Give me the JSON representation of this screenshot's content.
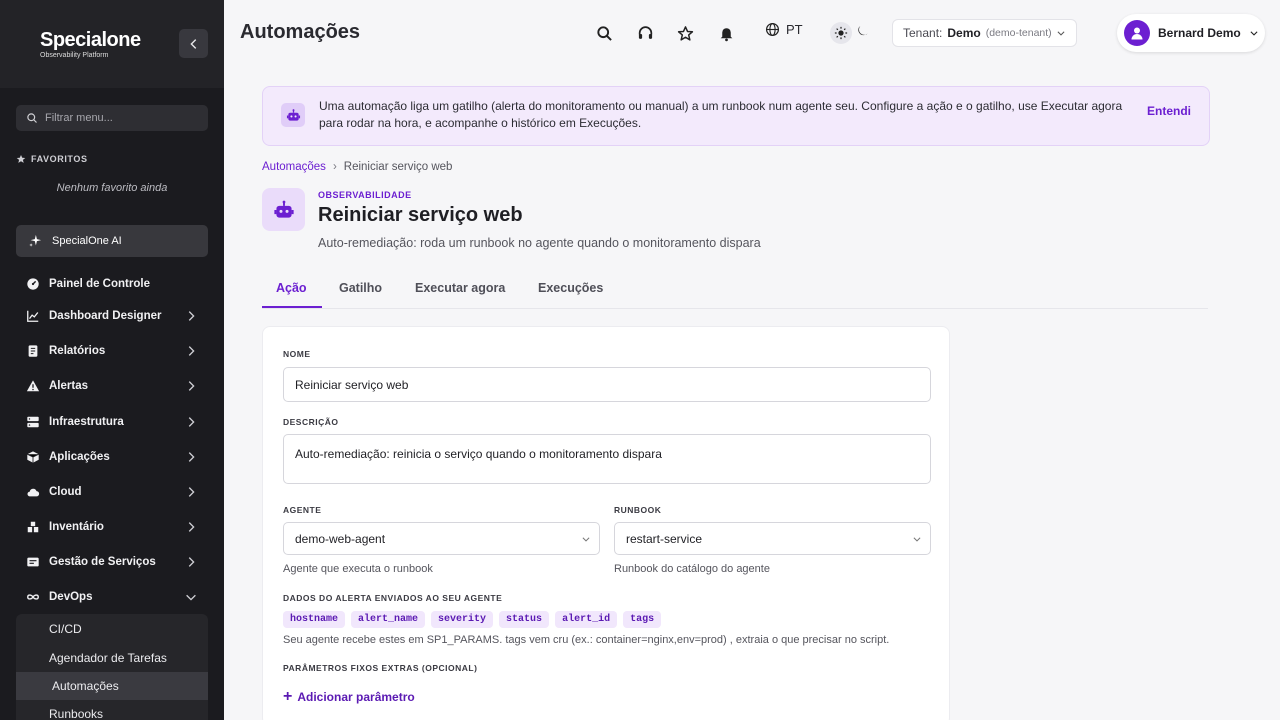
{
  "sidebar": {
    "logo_word": "Specialone",
    "logo_sub": "Observability Platform",
    "filter_placeholder": "Filtrar menu...",
    "favorites_title": "FAVORITOS",
    "favorites_empty": "Nenhum favorito ainda",
    "ai_label": "SpecialOne AI",
    "items": [
      {
        "label": "Painel de Controle",
        "icon": "dashboard-gauge-icon"
      },
      {
        "label": "Dashboard Designer",
        "icon": "chart-line-icon"
      },
      {
        "label": "Relatórios",
        "icon": "report-icon"
      },
      {
        "label": "Alertas",
        "icon": "warning-icon"
      },
      {
        "label": "Infraestrutura",
        "icon": "server-icon"
      },
      {
        "label": "Aplicações",
        "icon": "box-icon"
      },
      {
        "label": "Cloud",
        "icon": "cloud-icon"
      },
      {
        "label": "Inventário",
        "icon": "inventory-icon"
      },
      {
        "label": "Gestão de Serviços",
        "icon": "service-icon"
      },
      {
        "label": "DevOps",
        "icon": "infinity-icon"
      }
    ],
    "devops_sub": [
      "CI/CD",
      "Agendador de Tarefas",
      "Automações",
      "Runbooks"
    ]
  },
  "topbar": {
    "title": "Automações",
    "lang": "PT",
    "tenant_label": "Tenant:",
    "tenant_name": "Demo",
    "tenant_slug": "(demo-tenant)",
    "user_name": "Bernard Demo"
  },
  "banner": {
    "text": "Uma automação liga um gatilho (alerta do monitoramento ou manual) a um runbook num agente seu. Configure a ação e o gatilho, use Executar agora para rodar na hora, e acompanhe o histórico em Execuções.",
    "dismiss": "Entendi"
  },
  "breadcrumb": {
    "root": "Automações",
    "sep": "›",
    "current": "Reiniciar serviço web"
  },
  "header": {
    "eyebrow": "OBSERVABILIDADE",
    "title": "Reiniciar serviço web",
    "subtitle": "Auto-remediação: roda um runbook no agente quando o monitoramento dispara"
  },
  "tabs": [
    "Ação",
    "Gatilho",
    "Executar agora",
    "Execuções"
  ],
  "form": {
    "name_label": "NOME",
    "name_value": "Reiniciar serviço web",
    "desc_label": "DESCRIÇÃO",
    "desc_value": "Auto-remediação: reinicia o serviço quando o monitoramento dispara",
    "agent_label": "AGENTE",
    "agent_value": "demo-web-agent",
    "agent_help": "Agente que executa o runbook",
    "runbook_label": "RUNBOOK",
    "runbook_value": "restart-service",
    "runbook_help": "Runbook do catálogo do agente",
    "alert_data_label": "DADOS DO ALERTA ENVIADOS AO SEU AGENTE",
    "chips": [
      "hostname",
      "alert_name",
      "severity",
      "status",
      "alert_id",
      "tags"
    ],
    "alert_help": "Seu agente recebe estes em SP1_PARAMS. tags vem cru (ex.: container=nginx,env=prod) , extraia o que precisar no script.",
    "extra_label": "PARÂMETROS FIXOS EXTRAS (OPCIONAL)",
    "add_param": "Adicionar parâmetro"
  },
  "colors": {
    "accent": "#6c1fd1",
    "sidebar_bg": "#1b1b1f",
    "banner_bg": "#f3eafc"
  }
}
